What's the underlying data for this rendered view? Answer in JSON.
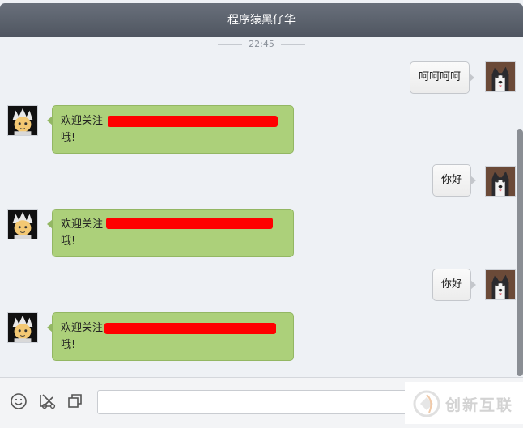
{
  "window": {
    "title": "程序猿黑仔华"
  },
  "chat": {
    "timestamp": "22:45",
    "messages": [
      {
        "from": "me",
        "text": "呵呵呵呵"
      },
      {
        "from": "bot",
        "prefix": "欢迎关注",
        "line2": "哦!"
      },
      {
        "from": "me",
        "text": "你好"
      },
      {
        "from": "bot",
        "prefix": "欢迎关注",
        "line2": "哦!"
      },
      {
        "from": "me",
        "text": "你好"
      },
      {
        "from": "bot",
        "prefix": "欢迎关注",
        "line2": "哦!"
      }
    ]
  },
  "toolbar": {
    "icons": [
      "emoji-icon",
      "screenshot-scissors-icon",
      "copy-window-icon"
    ],
    "input_value": ""
  },
  "watermark": {
    "text": "创新互联"
  },
  "colors": {
    "titlebar": "#5c626c",
    "bot_bubble": "#acd07a",
    "redaction": "#ff0000"
  }
}
